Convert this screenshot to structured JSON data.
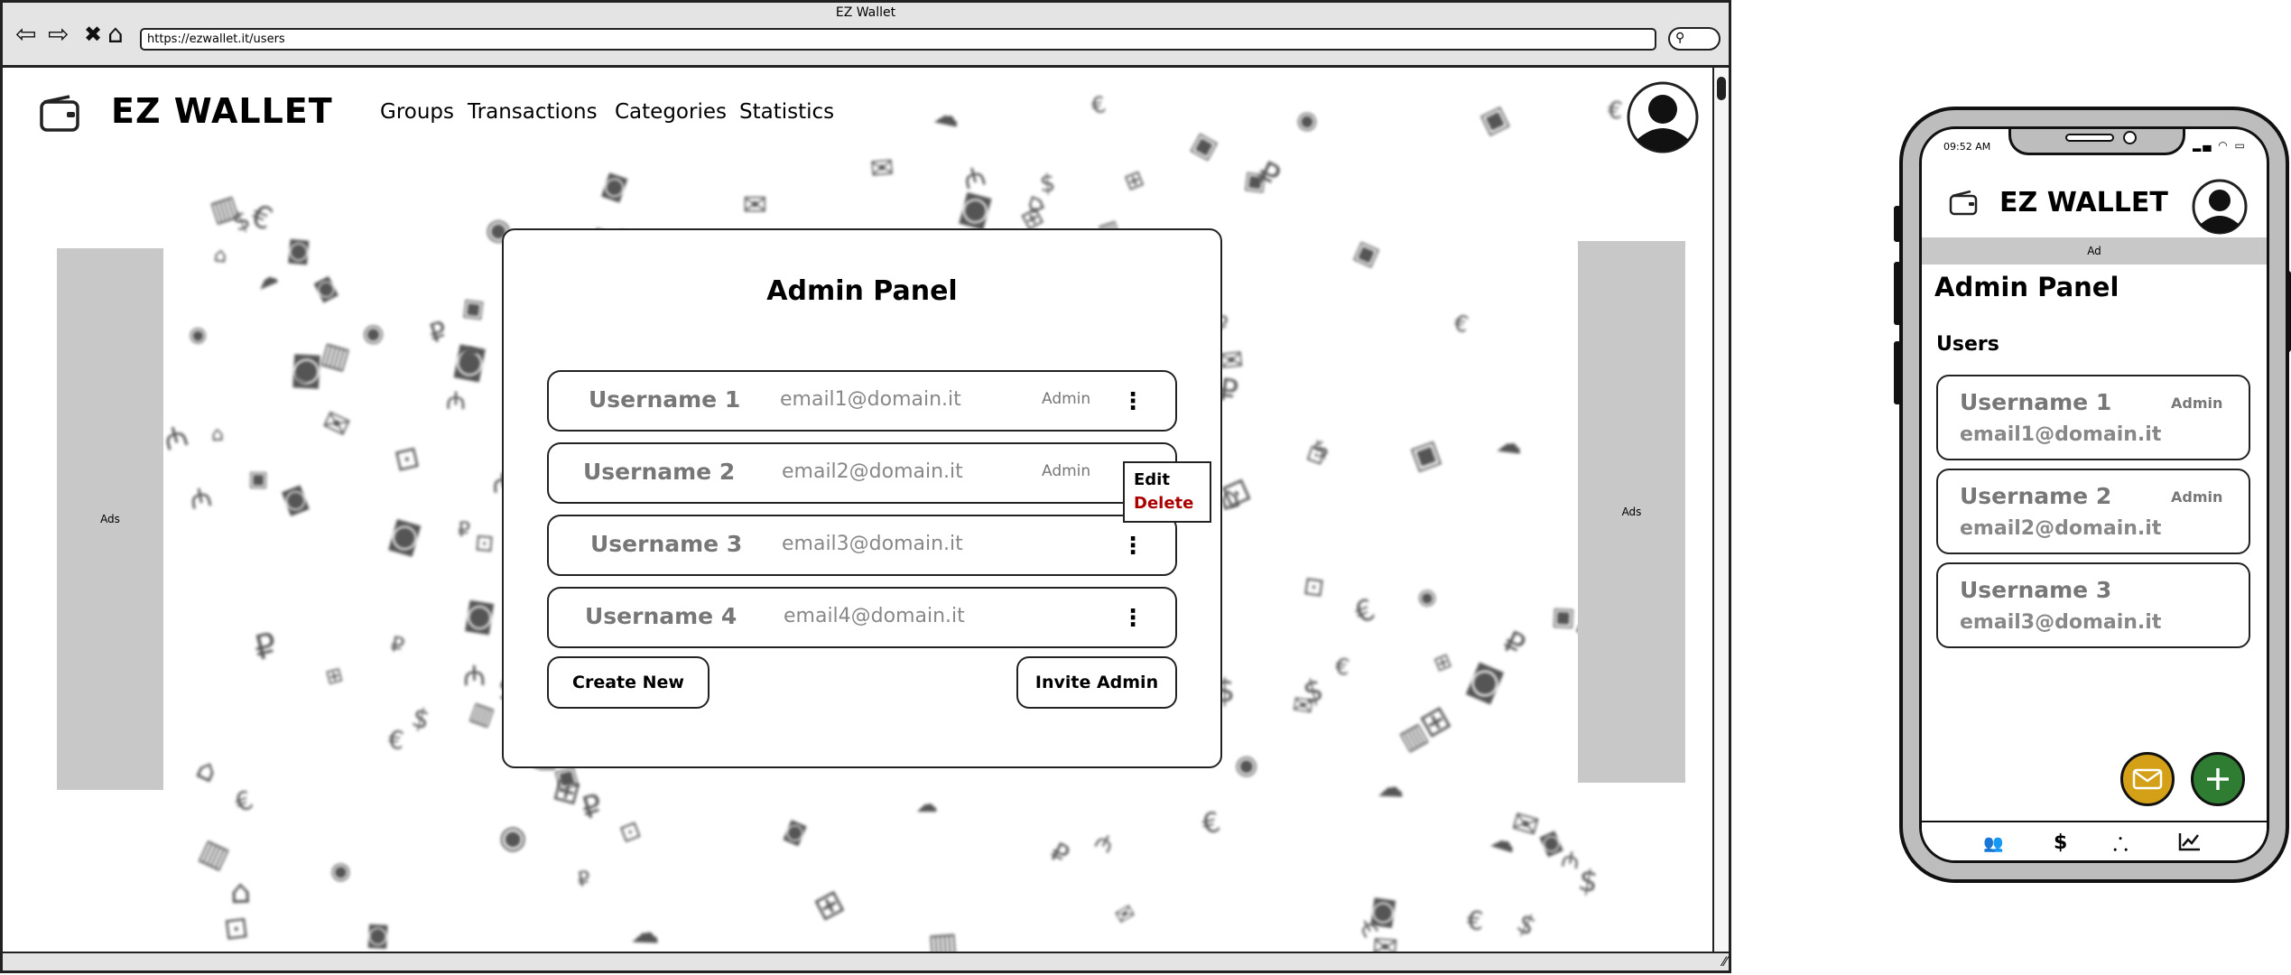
{
  "browser": {
    "window_title": "EZ Wallet",
    "url": "https://ezwallet.it/users",
    "back_icon": "back-arrow-icon",
    "forward_icon": "forward-arrow-icon",
    "close_icon": "close-icon",
    "home_icon": "home-icon",
    "search_icon": "search-icon"
  },
  "header": {
    "brand": "EZ WALLET",
    "nav": [
      "Groups",
      "Transactions",
      "Categories",
      "Statistics"
    ]
  },
  "ads": {
    "left": "Ads",
    "right": "Ads"
  },
  "admin_panel": {
    "title": "Admin Panel",
    "users": [
      {
        "name": "Username 1",
        "email": "email1@domain.it",
        "role": "Admin"
      },
      {
        "name": "Username 2",
        "email": "email2@domain.it",
        "role": "Admin"
      },
      {
        "name": "Username 3",
        "email": "email3@domain.it",
        "role": ""
      },
      {
        "name": "Username 4",
        "email": "email4@domain.it",
        "role": ""
      }
    ],
    "create_new_label": "Create New",
    "invite_admin_label": "Invite Admin",
    "context_menu": {
      "edit": "Edit",
      "delete": "Delete"
    }
  },
  "mobile": {
    "time": "09:52 AM",
    "brand": "EZ WALLET",
    "ad": "Ad",
    "title": "Admin Panel",
    "section": "Users",
    "users": [
      {
        "name": "Username 1",
        "email": "email1@domain.it",
        "role": "Admin"
      },
      {
        "name": "Username 2",
        "email": "email2@domain.it",
        "role": "Admin"
      },
      {
        "name": "Username 3",
        "email": "email3@domain.it",
        "role": ""
      }
    ],
    "fab_colors": {
      "mail": "#d4a017",
      "add": "#2e7d32"
    },
    "bottom_nav_icons": [
      "groups-icon",
      "dollar-icon",
      "categories-icon",
      "statistics-icon"
    ]
  }
}
